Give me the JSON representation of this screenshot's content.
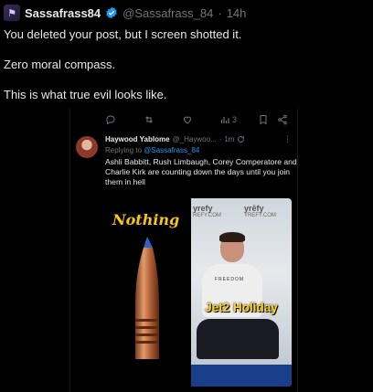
{
  "tweet": {
    "author_name": "Sassafrass84",
    "handle": "@Sassafrass_84",
    "separator": "·",
    "time": "14h",
    "lines": [
      "You deleted your post, but I screen shotted it.",
      "Zero moral compass.",
      "This is what true evil looks like."
    ]
  },
  "embedded": {
    "action_bar": {
      "views_count": "3"
    },
    "reply": {
      "author_name": "Haywood Yablome",
      "handle": "@_Haywoo...",
      "separator": "·",
      "time": "1m",
      "replying_prefix": "Replying to",
      "replying_to": "@Sassafrass_84",
      "body": "Ashli Babbitt, Rush Limbaugh, Corey Comperatore and Charlie Kirk are counting down the days until you join them in hell"
    },
    "media": {
      "left_caption": "Nothing",
      "right_banner": "Jet2 Holiday",
      "backdrop_brand_1": "yrefy",
      "backdrop_brand_2": "yrēfy",
      "backdrop_sub_1": "REFY.COM",
      "backdrop_sub_2": "YREFY.COM",
      "shirt_text": "FREEDOM"
    }
  },
  "colors": {
    "background": "#000000",
    "text_primary": "#e7e9ea",
    "text_secondary": "#71767b",
    "accent": "#1d9bf0",
    "caption_yellow": "#f5c518"
  },
  "icons": [
    "verified-badge-icon",
    "reply-icon",
    "retweet-icon",
    "like-icon",
    "views-icon",
    "bookmark-icon",
    "share-icon",
    "refresh-icon",
    "more-icon"
  ]
}
